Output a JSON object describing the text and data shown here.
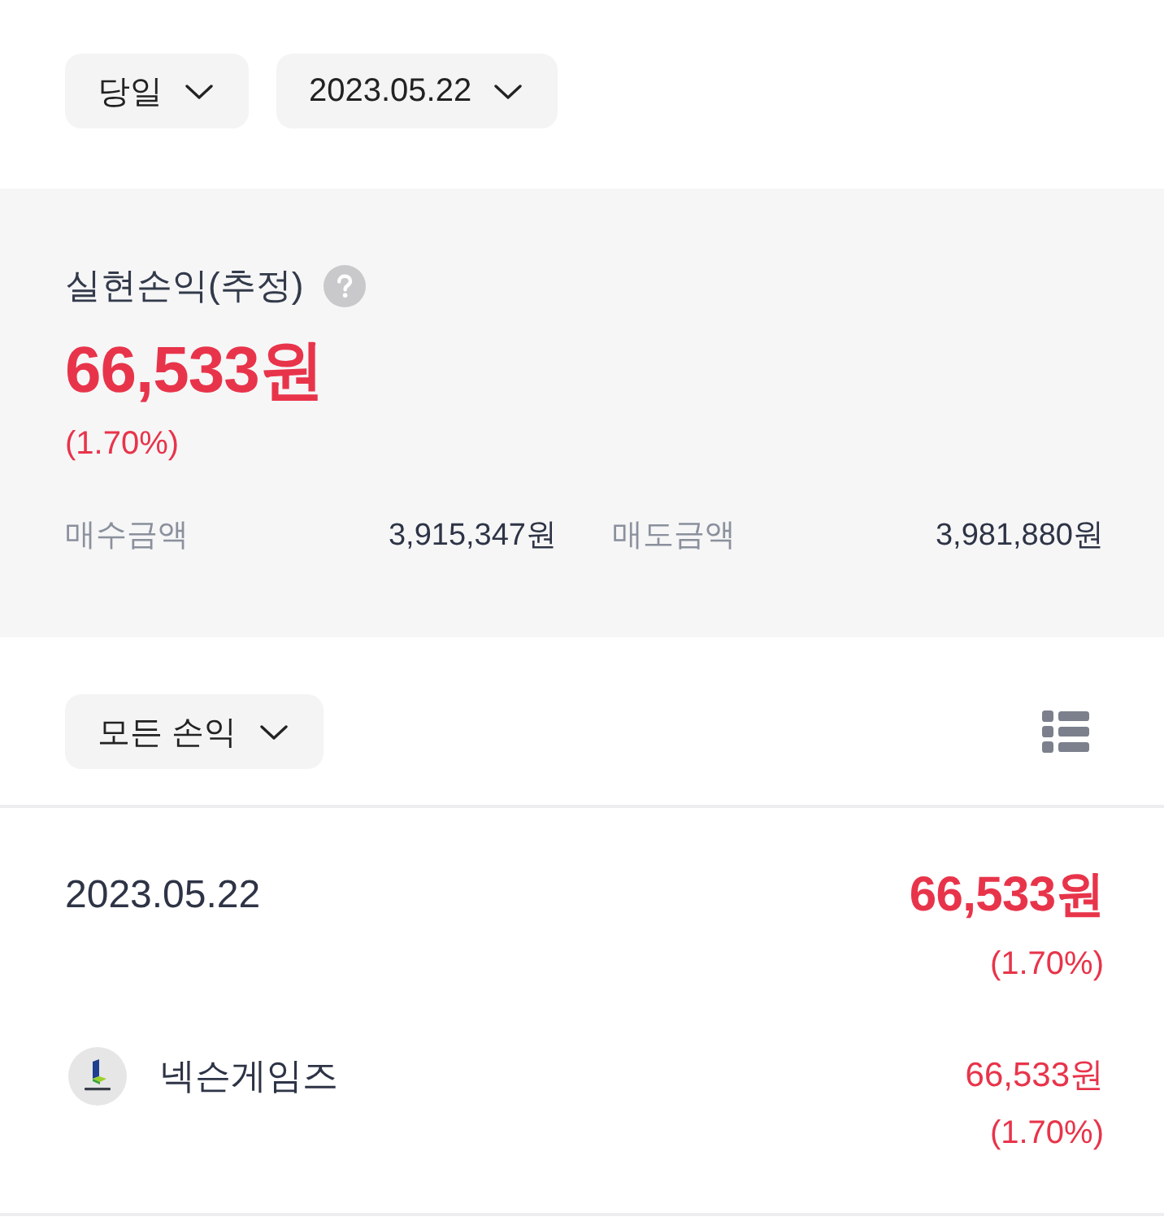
{
  "filters": [
    {
      "label": "당일"
    },
    {
      "label": "2023.05.22"
    }
  ],
  "summary": {
    "title": "실현손익(추정)",
    "gain": true,
    "profit": "66,533원",
    "rate": "(1.70%)",
    "stats": [
      {
        "label": "매수금액",
        "value": "3,915,347원"
      },
      {
        "label": "매도금액",
        "value": "3,981,880원"
      }
    ]
  },
  "list_filter": {
    "label": "모든 손익"
  },
  "days": [
    {
      "date": "2023.05.22",
      "gain": true,
      "profit": "66,533원",
      "rate": "(1.70%)",
      "stocks": [
        {
          "name": "넥슨게임즈",
          "gain": true,
          "profit": "66,533원",
          "rate": "(1.70%)"
        }
      ]
    }
  ]
}
